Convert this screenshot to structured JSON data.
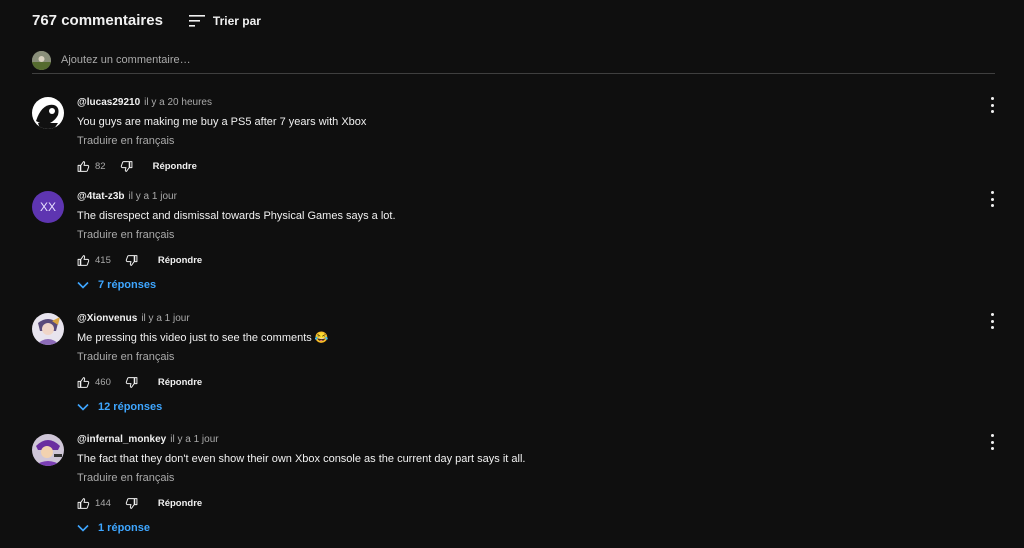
{
  "header": {
    "count": "767 commentaires",
    "sort_label": "Trier par"
  },
  "add_comment": {
    "placeholder": "Ajoutez un commentaire…"
  },
  "comments": [
    {
      "user": "@lucas29210",
      "time": "il y a 20 heures",
      "text": "You guys are making me buy a PS5 after 7 years with Xbox",
      "translate": "Traduire en français",
      "likes": "82",
      "reply_label": "Répondre",
      "replies": "",
      "avatar_icon": "black-white-cartoon-avatar"
    },
    {
      "user": "@4tat-z3b",
      "time": "il y a 1 jour",
      "text": "The disrespect and dismissal towards Physical Games says a lot.",
      "translate": "Traduire en français",
      "likes": "415",
      "reply_label": "Répondre",
      "replies": "7 réponses",
      "avatar_initials": "XX",
      "avatar_color": "#5e35b1"
    },
    {
      "user": "@Xionvenus",
      "time": "il y a 1 jour",
      "text": "Me pressing this video just to see the comments",
      "emoji": "😂",
      "translate": "Traduire en français",
      "likes": "460",
      "reply_label": "Répondre",
      "replies": "12 réponses",
      "avatar_icon": "anime-character-avatar"
    },
    {
      "user": "@infernal_monkey",
      "time": "il y a 1 jour",
      "text": "The fact that they don't even show their own Xbox console as the current day part says it all.",
      "translate": "Traduire en français",
      "likes": "144",
      "reply_label": "Répondre",
      "replies": "1 réponse",
      "avatar_icon": "purple-character-avatar"
    }
  ]
}
